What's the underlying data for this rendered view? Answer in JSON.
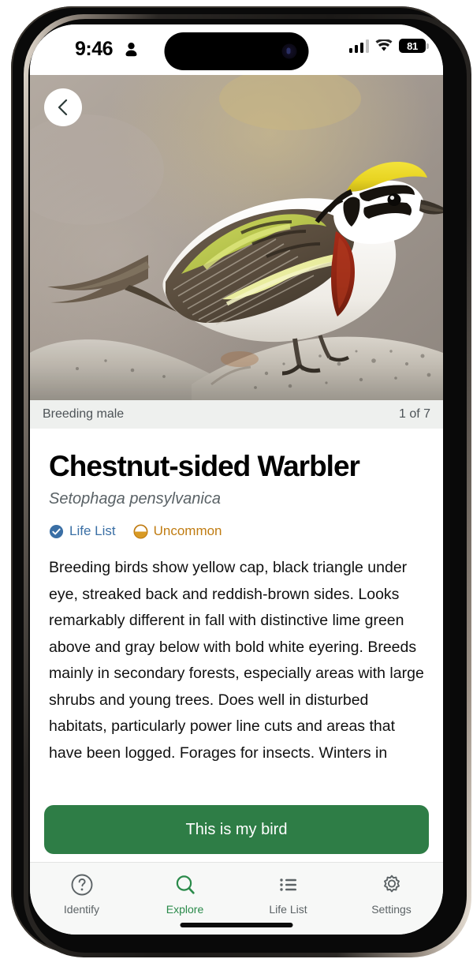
{
  "status_bar": {
    "time": "9:46",
    "person_icon": "person-icon",
    "battery_level": "81",
    "signal_icon": "cellular-signal-icon",
    "wifi_icon": "wifi-icon"
  },
  "hero": {
    "back_icon": "chevron-left-icon",
    "photo_alt": "Chestnut-sided Warbler perched on a lichen-covered rock",
    "caption": "Breeding male",
    "counter": "1 of 7"
  },
  "species": {
    "common_name": "Chestnut-sided Warbler",
    "scientific_name": "Setophaga pensylvanica",
    "badges": [
      {
        "icon": "check-circle-icon",
        "label": "Life List",
        "color": "#3a6fa5"
      },
      {
        "icon": "half-filled-circle-icon",
        "label": "Uncommon",
        "color": "#c07c12"
      }
    ],
    "description": "Breeding birds show yellow cap, black triangle under eye, streaked back and reddish-brown sides. Looks remarkably different in fall with distinctive lime green above and gray below with bold white eyering. Breeds mainly in secondary forests, especially areas with large shrubs and young trees. Does well in disturbed habitats, particularly power line cuts and areas that have been logged. Forages for insects. Winters in"
  },
  "cta": {
    "label": "This is my bird",
    "color": "#2e7d46"
  },
  "tab_bar": {
    "active_color": "#2a8a4a",
    "items": [
      {
        "icon": "question-circle-icon",
        "label": "Identify",
        "active": false
      },
      {
        "icon": "search-icon",
        "label": "Explore",
        "active": true
      },
      {
        "icon": "list-icon",
        "label": "Life List",
        "active": false
      },
      {
        "icon": "gear-icon",
        "label": "Settings",
        "active": false
      }
    ]
  }
}
